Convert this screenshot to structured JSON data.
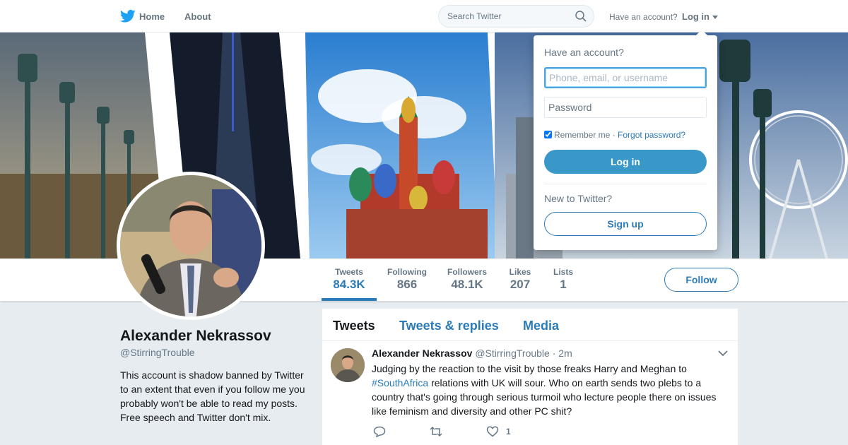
{
  "nav": {
    "home": "Home",
    "about": "About",
    "search_placeholder": "Search Twitter",
    "have_account": "Have an account?",
    "login": "Log in"
  },
  "profile": {
    "name": "Alexander Nekrassov",
    "handle": "@StirringTrouble",
    "bio": "This account is shadow banned by Twitter to an extent that even if you follow me you probably won't be able to read my posts. Free speech and Twitter don't mix.",
    "follow": "Follow",
    "stats": [
      {
        "label": "Tweets",
        "value": "84.3K"
      },
      {
        "label": "Following",
        "value": "866"
      },
      {
        "label": "Followers",
        "value": "48.1K"
      },
      {
        "label": "Likes",
        "value": "207"
      },
      {
        "label": "Lists",
        "value": "1"
      }
    ]
  },
  "tabs": [
    "Tweets",
    "Tweets & replies",
    "Media"
  ],
  "tweet": {
    "name": "Alexander Nekrassov",
    "handle": "@StirringTrouble",
    "sep": "·",
    "time": "2m",
    "text_before": "Judging by the reaction to the visit by those freaks Harry and Meghan to",
    "hashtag": "#SouthAfrica",
    "text_after": "relations with UK will sour. Who on earth sends two plebs to a country that's going through serious turmoil who lecture people there on issues like feminism and diversity and other PC shit?",
    "like_count": "1"
  },
  "login_dropdown": {
    "title": "Have an account?",
    "username_placeholder": "Phone, email, or username",
    "password_placeholder": "Password",
    "remember": "Remember me",
    "sep": "·",
    "forgot": "Forgot password?",
    "login_button": "Log in",
    "new_to": "New to Twitter?",
    "signup_button": "Sign up"
  },
  "colors": {
    "accent": "#2b7bb9",
    "login_button": "#3a98c9",
    "page_bg": "#e6ecf0"
  }
}
